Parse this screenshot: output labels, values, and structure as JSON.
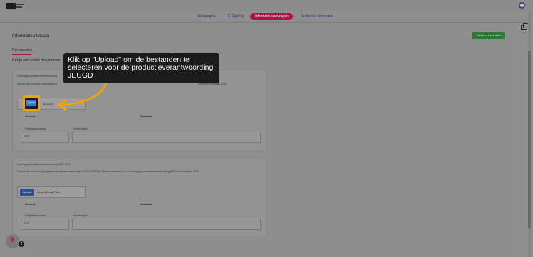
{
  "nav": {
    "items": [
      {
        "label": "Startpagina",
        "active": false
      },
      {
        "label": "E-Signing",
        "active": false
      },
      {
        "label": "Informatie aanvragen",
        "active": true
      },
      {
        "label": "Gedeelde informatie",
        "active": false
      }
    ]
  },
  "page": {
    "title": "Informatieuitvraag",
    "action_label": "Verstuur naar klant",
    "tab_label": "Documenten",
    "intro_text": "Er zijn een aantal documenten"
  },
  "sections": [
    {
      "title": "Voorlopige productieverantwoording",
      "description": "Upload hier uw Excel (goedgekeurd)",
      "description_end": "ening voor boekjaar 2025.",
      "upload_label": "Upload",
      "drop_label": "g & Dro",
      "col_file": "Bestand",
      "col_date": "Einddatum",
      "reg_label": "Registratienummer",
      "reg_value": "N.v.t.",
      "notes_label": "Opmerkingen"
    },
    {
      "title": "Voorlopige productieverantwoording WMO 2025",
      "description": "Upload hier uw Excel (goedgekeurd) naar de bestandstype XLS of OPPT en Pvf documenten t.b.v. de voorlopige productieverantwoording WMO voor boekjaar 2025.",
      "upload_label": "Upload",
      "drop_label": "Drag & Drop Files",
      "col_file": "Bestand",
      "col_date": "Einddatum",
      "reg_label": "Registratienummer",
      "reg_value": "N.v.t.",
      "notes_label": "Opmerkingen"
    }
  ],
  "tooltip": {
    "text": "Klik op \"Upload\" om de bestanden te selecteren voor de productieverantwoording JEUGD"
  },
  "help": {
    "count": "2"
  },
  "colors": {
    "accent": "#b0134a",
    "highlight": "#f2a20c",
    "green": "#2f7a2f",
    "upload_blue": "#3d7cd9"
  }
}
